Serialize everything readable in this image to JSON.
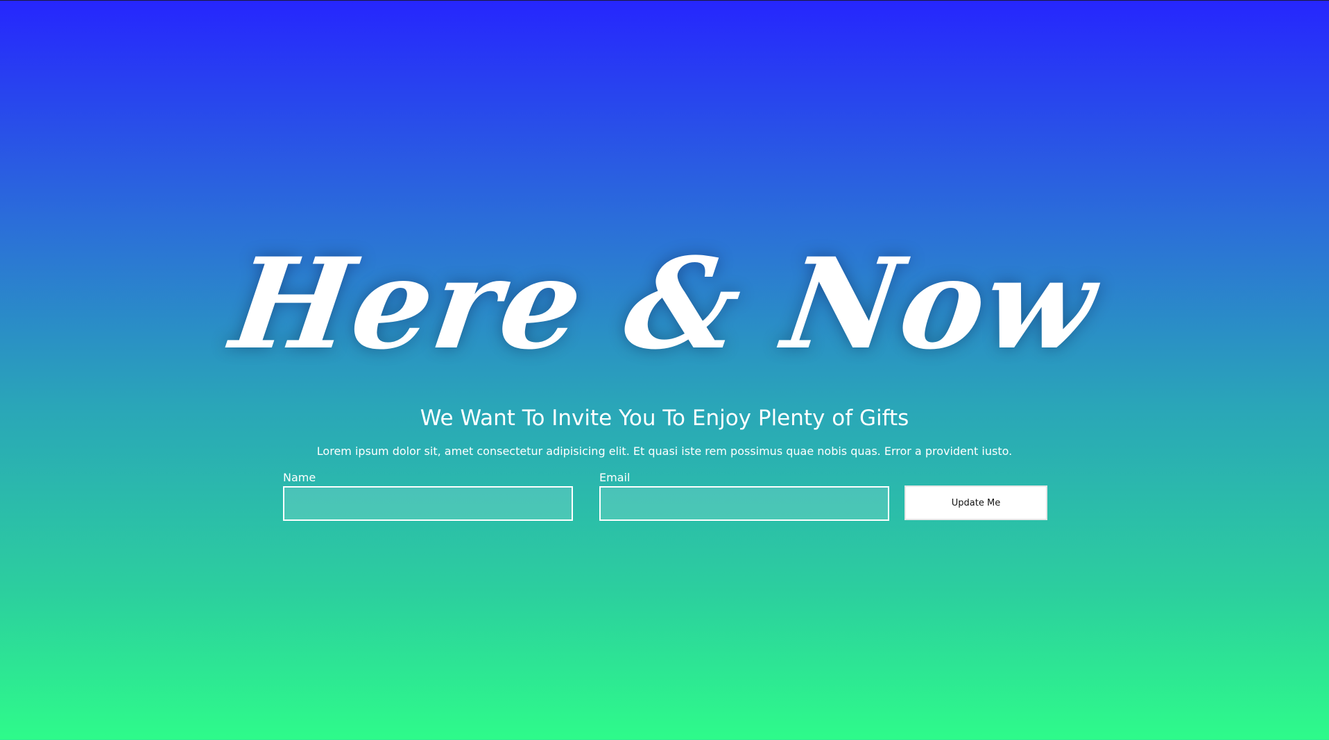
{
  "hero": {
    "title": "Here & Now",
    "subtitle": "We Want To Invite You To Enjoy Plenty of Gifts",
    "description": "Lorem ipsum dolor sit, amet consectetur adipisicing elit. Et quasi iste rem possimus quae nobis quas. Error a provident iusto."
  },
  "form": {
    "name_label": "Name",
    "name_value": "",
    "email_label": "Email",
    "email_value": "",
    "submit_label": "Update Me"
  },
  "colors": {
    "gradient_top": "#2626fe",
    "gradient_bottom": "#2efb8a",
    "text": "#ffffff",
    "button_bg": "#ffffff",
    "button_text": "#111111"
  }
}
